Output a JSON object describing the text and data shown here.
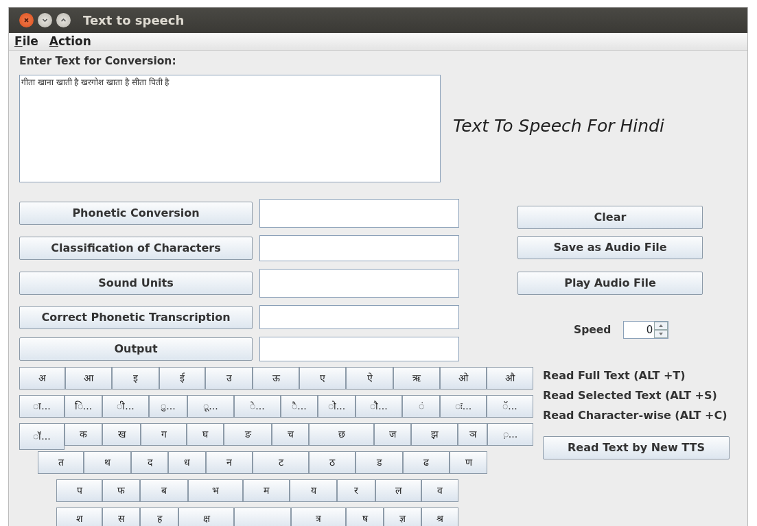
{
  "window": {
    "title": "Text to speech"
  },
  "menu": [
    "File",
    "Action"
  ],
  "input": {
    "label": "Enter Text for Conversion:",
    "value": "गीता खाना खाती है खरगोश खाता है सीता पिती है"
  },
  "heading": "Text To Speech For Hindi",
  "steps": [
    {
      "button": "Phonetic Conversion"
    },
    {
      "button": "Classification of Characters"
    },
    {
      "button": "Sound Units"
    },
    {
      "button": "Correct Phonetic Transcription"
    },
    {
      "button": "Output"
    }
  ],
  "actions": [
    "Clear",
    "Save as Audio File",
    "Play Audio File"
  ],
  "speed": {
    "label": "Speed",
    "value": "0"
  },
  "keyboard": [
    [
      "अ",
      "आ",
      "इ",
      "ई",
      "उ",
      "ऊ",
      "ए",
      "ऐ",
      "ऋ",
      "ओ",
      "औ"
    ],
    [
      "ा...",
      "ि...",
      "ी...",
      "ु...",
      "ू...",
      "े...",
      "ै...",
      "ो...",
      "ौ...",
      "ं",
      "ः...",
      "ॅ..."
    ],
    [
      "ॉ...",
      "क",
      "ख",
      "ग",
      "घ",
      "ङ",
      "च",
      "छ",
      "ज",
      "झ",
      "ञ",
      "़..."
    ],
    [
      "त",
      "थ",
      "द",
      "ध",
      "न",
      "ट",
      "ठ",
      "ड",
      "ढ",
      "ण"
    ],
    [
      "प",
      "फ",
      "ब",
      "भ",
      "म",
      "य",
      "र",
      "ल",
      "व"
    ],
    [
      "श",
      "स",
      "ह",
      "क्ष",
      {
        "kind": "blank"
      },
      "त्र",
      "ष",
      "ज्ञ",
      "श्र"
    ]
  ],
  "shortcuts": [
    "Read Full Text (ALT +T)",
    "Read Selected Text (ALT +S)",
    "Read Character-wise (ALT +C)"
  ],
  "new_tts_button": "Read Text by New TTS"
}
